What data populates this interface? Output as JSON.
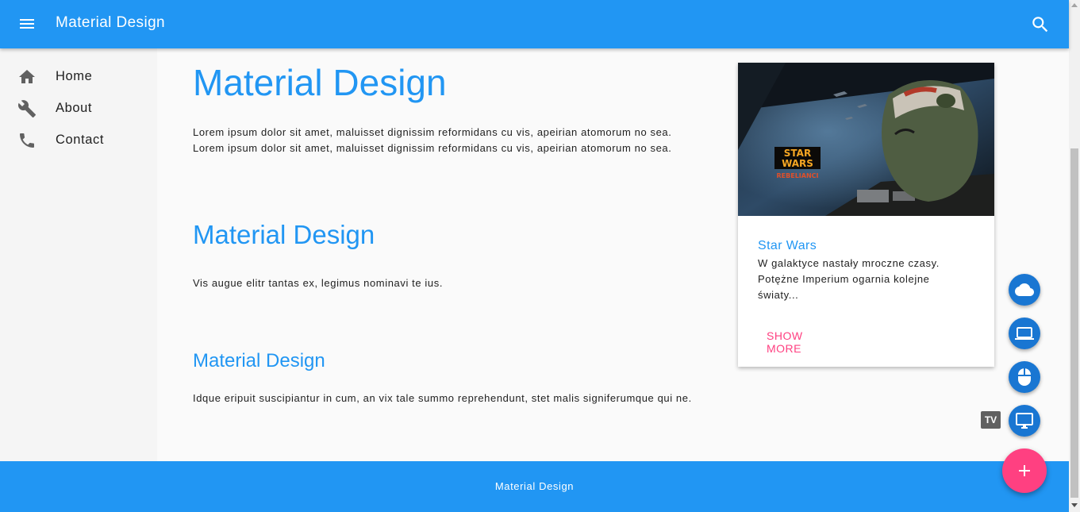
{
  "appbar": {
    "title": "Material Design",
    "menu_icon": "menu-icon",
    "search_icon": "search-icon"
  },
  "sidebar": {
    "items": [
      {
        "label": "Home",
        "icon": "home-icon"
      },
      {
        "label": "About",
        "icon": "wrench-icon"
      },
      {
        "label": "Contact",
        "icon": "phone-icon"
      }
    ]
  },
  "main": {
    "heading1": "Material Design",
    "para1_line1": "Lorem ipsum dolor sit amet, maluisset dignissim reformidans cu vis, apeirian atomorum no sea.",
    "para1_line2": "Lorem ipsum dolor sit amet, maluisset dignissim reformidans cu vis, apeirian atomorum no sea.",
    "heading2": "Material Design",
    "para2": "Vis augue elitr tantas ex, legimus nominavi te ius.",
    "heading3": "Material Design",
    "para3": "Idque eripuit suscipiantur in cum, an vix tale summo reprehendunt, stet malis signiferumque qui ne."
  },
  "card": {
    "logo_star": "STAR",
    "logo_wars": "WARS",
    "logo_sub": "REBELIANCI",
    "title": "Star Wars",
    "text": "W galaktyce nastały mroczne czasy. Potężne Imperium ogarnia kolejne światy...",
    "button": "SHOW MORE"
  },
  "footer": {
    "text": "Material Design"
  },
  "speed_dial": {
    "actions": [
      {
        "icon": "cloud-icon"
      },
      {
        "icon": "laptop-icon"
      },
      {
        "icon": "mouse-icon"
      },
      {
        "icon": "tv-icon"
      }
    ],
    "tooltip": "TV",
    "main_icon": "add-icon"
  },
  "colors": {
    "primary": "#2196f3",
    "accent": "#ff4081",
    "mini_fab": "#1976d2"
  }
}
